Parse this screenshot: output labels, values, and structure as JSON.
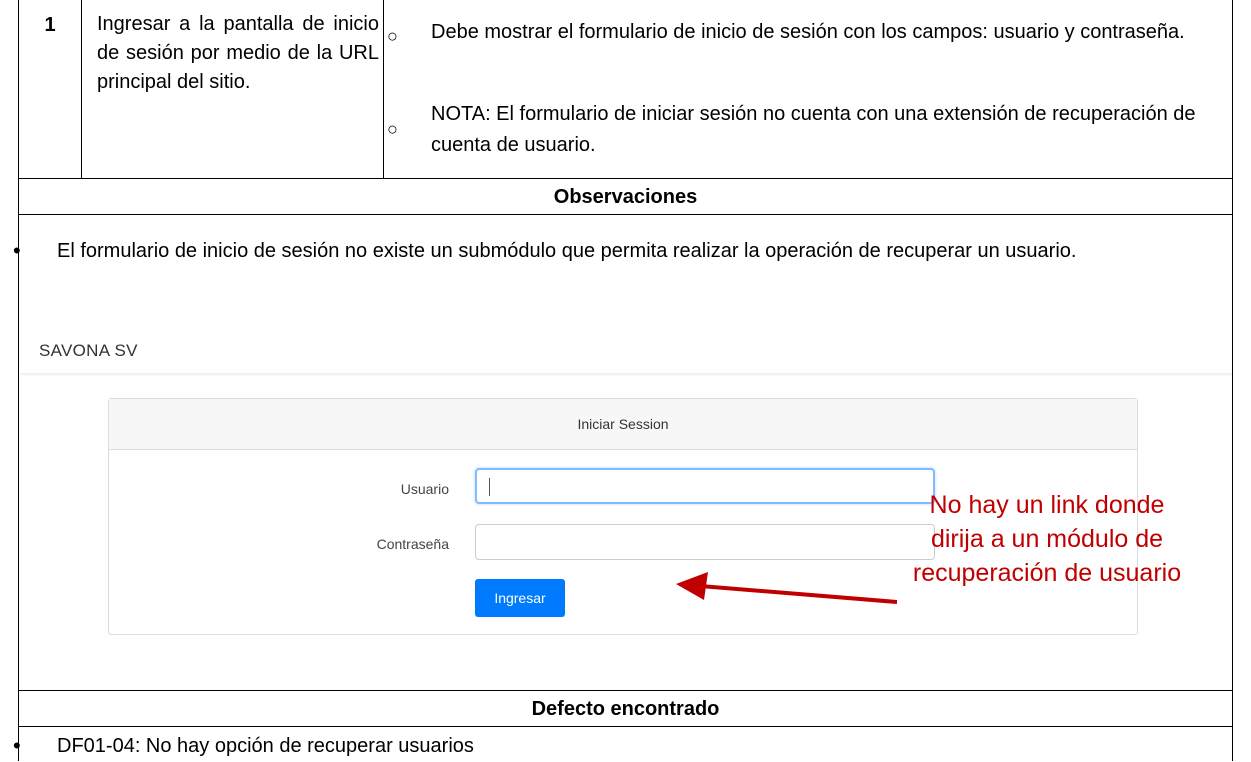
{
  "step": {
    "number": "1",
    "description": "Ingresar a la pantalla de inicio de sesión por medio de la URL principal del sitio.",
    "expected": [
      "Debe mostrar el formulario de inicio de sesión con los campos: usuario y contraseña.",
      "NOTA: El formulario de iniciar sesión no cuenta con una extensión de recuperación de cuenta de usuario."
    ]
  },
  "observations": {
    "heading": "Observaciones",
    "items": [
      "El formulario de inicio de sesión no existe un submódulo que permita realizar la operación de recuperar un usuario."
    ]
  },
  "screenshot": {
    "brand": "SAVONA SV",
    "card_title": "Iniciar Session",
    "user_label": "Usuario",
    "password_label": "Contraseña",
    "submit_label": "Ingresar",
    "annotation": "No hay un link donde dirija a un módulo de recuperación de usuario",
    "annotation_color": "#c00000",
    "button_color": "#007bff"
  },
  "defects": {
    "heading": "Defecto encontrado",
    "items": [
      "DF01-04: No hay opción de recuperar usuarios"
    ]
  }
}
